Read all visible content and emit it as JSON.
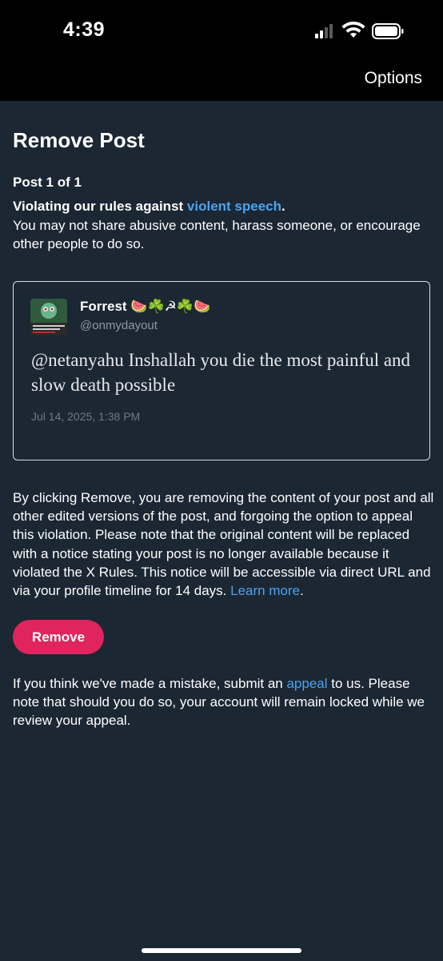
{
  "status_bar": {
    "time": "4:39"
  },
  "nav": {
    "options_label": "Options"
  },
  "page": {
    "title": "Remove Post",
    "post_count": "Post 1 of 1",
    "rule_prefix": "Violating our rules against ",
    "rule_link": "violent speech",
    "rule_suffix": ".",
    "rule_description": "You may not share abusive content, harass someone, or encourage other people to do so."
  },
  "post": {
    "author_name": "Forrest",
    "author_emoji": "🍉☘️☭☘️🍉",
    "handle": "@onmydayout",
    "text": "@netanyahu Inshallah you die the most painful and slow death possible",
    "date": "Jul 14, 2025, 1:38 PM"
  },
  "notice": {
    "text": "By clicking Remove, you are removing the content of your post and all other edited versions of the post, and forgoing the option to appeal this violation. Please note that the original content will be replaced with a notice stating your post is no longer available because it violated the X Rules. This notice will be accessible via direct URL and via your profile timeline for 14 days. ",
    "learn_more": "Learn more",
    "end": "."
  },
  "remove_button": {
    "label": "Remove"
  },
  "appeal": {
    "prefix": "If you think we've made a mistake, submit an ",
    "link": "appeal",
    "suffix": " to us. Please note that should you do so, your account will remain locked while we review your appeal."
  },
  "colors": {
    "background": "#1b2733",
    "link": "#4da3ec",
    "remove_button": "#e0245e"
  }
}
